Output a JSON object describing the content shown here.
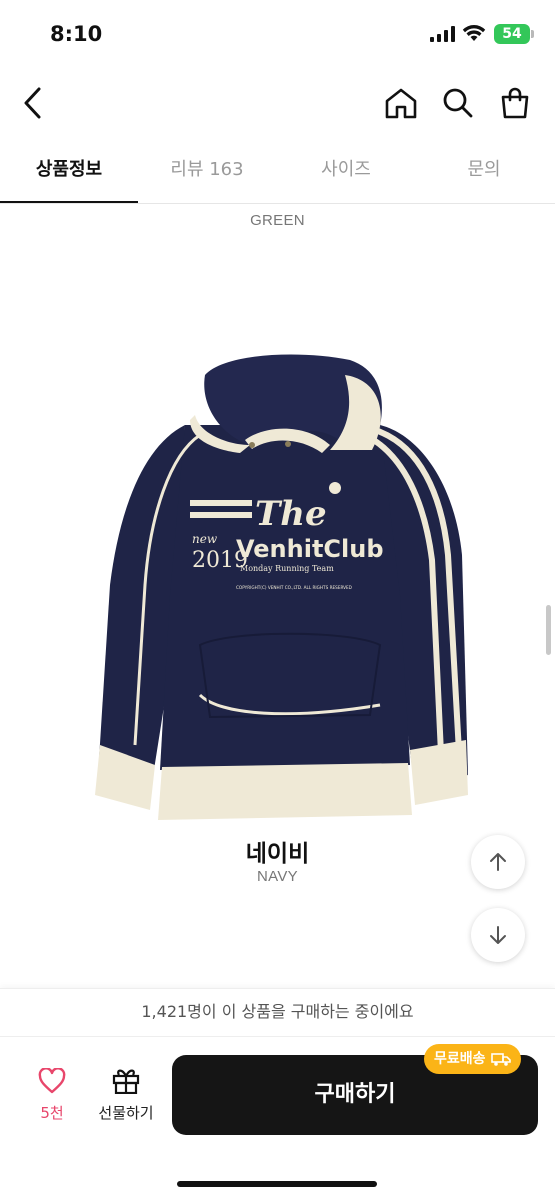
{
  "status_bar": {
    "time": "8:10",
    "battery": "54"
  },
  "tabs": [
    {
      "label": "상품정보",
      "active": true
    },
    {
      "label": "리뷰 163",
      "active": false
    },
    {
      "label": "사이즈",
      "active": false
    },
    {
      "label": "문의",
      "active": false
    }
  ],
  "content": {
    "prev_color_en": "GREEN",
    "color_name_ko": "네이비",
    "color_name_en": "NAVY",
    "hoodie_print": {
      "the": "The",
      "new": "new",
      "year": "2019",
      "club": "VenhitClub",
      "team": "Monday Running Team",
      "copyright": "COPYRIGHT(C) VENHIT CO.,LTD. ALL RIGHTS RESERVED"
    }
  },
  "bottom": {
    "buyer_note": "1,421명이 이 상품을 구매하는 중이에요",
    "like_count": "5천",
    "gift_label": "선물하기",
    "buy_label": "구매하기",
    "shipping_badge": "무료배송"
  },
  "colors": {
    "accent_like": "#e8466b",
    "badge": "#fbb417",
    "hoodie_body": "#1f2447",
    "hoodie_trim": "#efe9d6"
  },
  "icons": [
    "back-icon",
    "home-icon",
    "search-icon",
    "shopping-bag-icon",
    "heart-icon",
    "gift-icon",
    "arrow-up-icon",
    "arrow-down-icon",
    "truck-icon"
  ]
}
